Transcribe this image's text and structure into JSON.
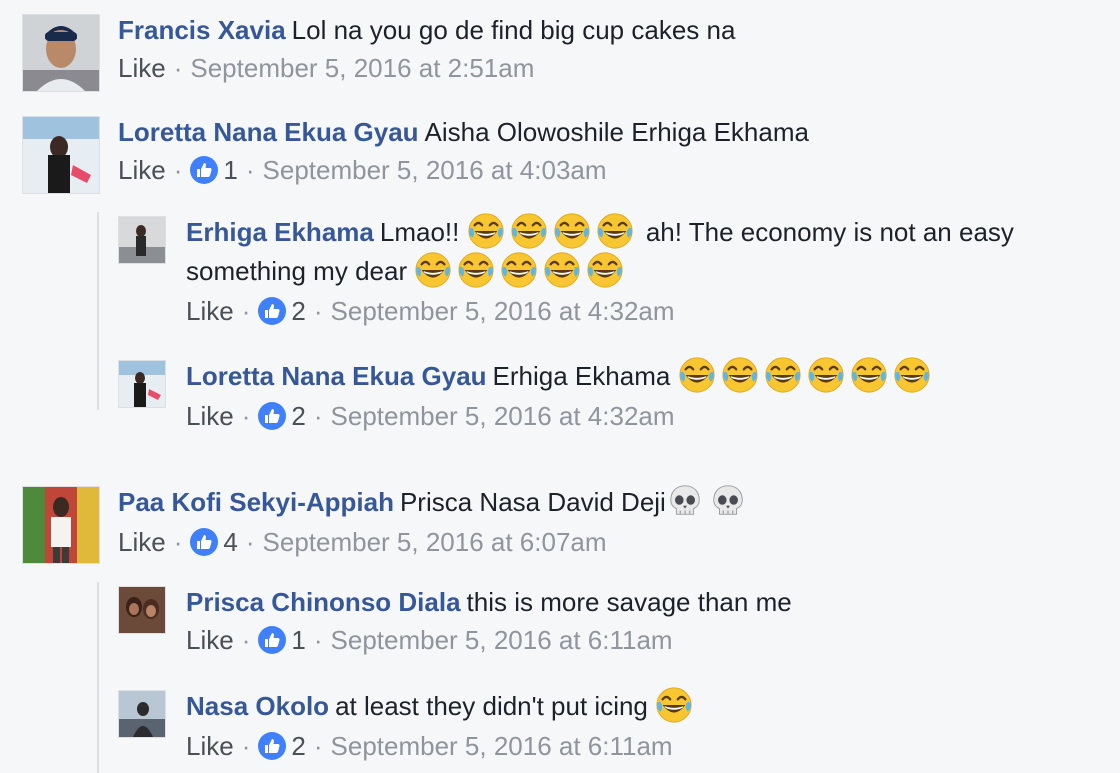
{
  "comments": [
    {
      "author": "Francis Xavia",
      "text": "Lol na you go de find big cup cakes na",
      "like_label": "Like",
      "timestamp": "September 5, 2016 at 2:51am",
      "reaction_count": null
    },
    {
      "author": "Loretta Nana Ekua Gyau",
      "text": "Aisha Olowoshile Erhiga Ekhama",
      "like_label": "Like",
      "timestamp": "September 5, 2016 at 4:03am",
      "reaction_count": "1",
      "replies": [
        {
          "author": "Erhiga Ekhama",
          "text_before": "Lmao!!",
          "text_after": "ah! The economy is not an easy",
          "text_line2": "something my dear",
          "emoji_first": 4,
          "emoji_second": 5,
          "emoji_name": "face-with-tears-of-joy",
          "like_label": "Like",
          "reaction_count": "2",
          "timestamp": "September 5, 2016 at 4:32am"
        },
        {
          "author": "Loretta Nana Ekua Gyau",
          "text": "Erhiga Ekhama",
          "emoji_count": 6,
          "emoji_name": "face-with-tears-of-joy",
          "like_label": "Like",
          "reaction_count": "2",
          "timestamp": "September 5, 2016 at 4:32am"
        }
      ]
    },
    {
      "author": "Paa Kofi Sekyi-Appiah",
      "text": "Prisca Nasa David Deji",
      "emoji_count": 2,
      "emoji_name": "skull",
      "like_label": "Like",
      "timestamp": "September 5, 2016 at 6:07am",
      "reaction_count": "4",
      "replies": [
        {
          "author": "Prisca Chinonso Diala",
          "text": "this is more savage than me",
          "like_label": "Like",
          "reaction_count": "1",
          "timestamp": "September 5, 2016 at 6:11am"
        },
        {
          "author": "Nasa Okolo",
          "text": "at least they didn't put icing",
          "emoji_count": 1,
          "emoji_name": "face-with-tears-of-joy",
          "like_label": "Like",
          "reaction_count": "2",
          "timestamp": "September 5, 2016 at 6:11am"
        }
      ]
    }
  ],
  "separator": "·",
  "colors": {
    "author": "#365899",
    "text": "#1d2129",
    "meta": "#90949c",
    "like_blue": "#4080ff",
    "background": "#f6f7f9"
  }
}
